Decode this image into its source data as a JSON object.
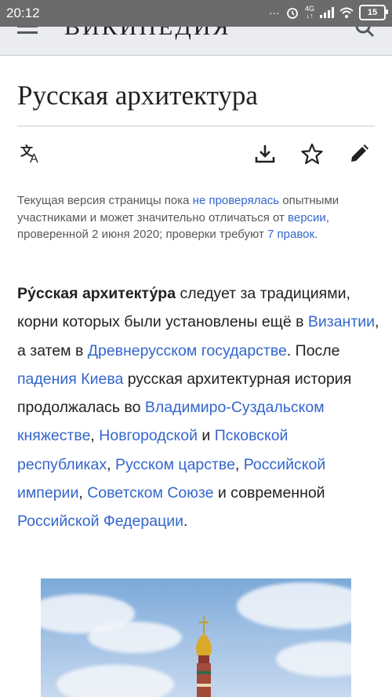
{
  "status": {
    "time": "20:12",
    "signal": "4G",
    "battery": "15"
  },
  "header": {
    "logo": "ВИКИПЕДИЯ"
  },
  "article": {
    "title": "Русская архитектура"
  },
  "notice": {
    "t1": "Текущая версия страницы пока ",
    "l1": "не проверялась",
    "t2": " опытными участниками и может значительно отличаться от ",
    "l2": "версии",
    "t3": ", проверенной 2 июня 2020; проверки требуют ",
    "l3": "7 правок",
    "t4": "."
  },
  "lead": {
    "bold": "Ру́сская архитекту́ра",
    "t1": " следует за традициями, корни которых были установлены ещё в ",
    "l1": "Византии",
    "t2": ", а затем в ",
    "l2": "Древнерусском государстве",
    "t3": ". После ",
    "l3": "падения Киева",
    "t4": " русская архитектурная история продолжалась во ",
    "l4": "Владимиро-Суздальском княжестве",
    "t5": ", ",
    "l5": "Новгородской",
    "t6": " и ",
    "l6": "Псковской республиках",
    "t7": ", ",
    "l7": "Русском царстве",
    "t8": ", ",
    "l8": "Российской империи",
    "t9": ", ",
    "l9": "Советском Союзе",
    "t10": " и современной ",
    "l10": "Российской Федерации",
    "t11": "."
  },
  "icons": {
    "language": "translate-icon",
    "download": "download-icon",
    "watch": "star-icon",
    "edit": "pencil-icon"
  },
  "colors": {
    "link": "#3366cc",
    "text": "#202122",
    "muted": "#54595d",
    "header_bg": "#eaecf0",
    "statusbar": "#6b6b6b"
  }
}
